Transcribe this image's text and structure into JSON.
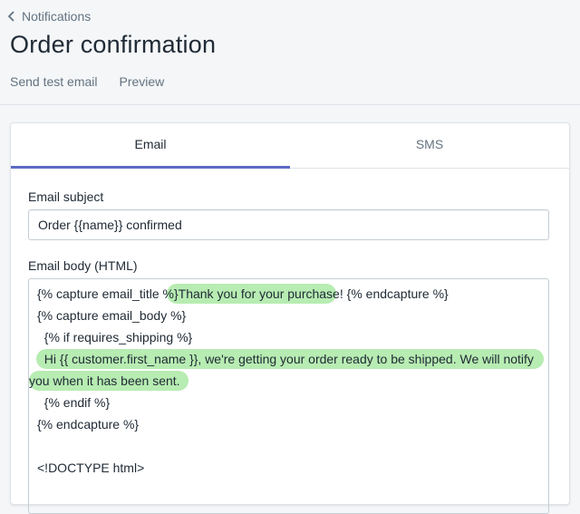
{
  "breadcrumb": {
    "label": "Notifications"
  },
  "page": {
    "title": "Order confirmation"
  },
  "actions": {
    "send_test": "Send test email",
    "preview": "Preview"
  },
  "tabs": [
    {
      "label": "Email",
      "active": true
    },
    {
      "label": "SMS",
      "active": false
    }
  ],
  "subject": {
    "label": "Email subject",
    "value": "Order {{name}} confirmed"
  },
  "body": {
    "label": "Email body (HTML)",
    "lines": [
      {
        "pre": "{% capture email_title %}",
        "highlight": "Thank you for your purchase!",
        "post": " {% endcapture %}"
      },
      {
        "pre": "{% capture email_body %}",
        "highlight": "",
        "post": ""
      },
      {
        "pre": "  {% if requires_shipping %}",
        "highlight": "",
        "post": ""
      },
      {
        "pre": "",
        "highlight": "  Hi {{ customer.first_name }}, we're getting your order ready to be shipped. We will notify",
        "post": ""
      },
      {
        "pre": "",
        "highlight": "you when it has been sent.",
        "post": ""
      },
      {
        "pre": "  {% endif %}",
        "highlight": "",
        "post": ""
      },
      {
        "pre": "{% endcapture %}",
        "highlight": "",
        "post": ""
      },
      {
        "pre": "",
        "highlight": "",
        "post": ""
      },
      {
        "pre": "<!DOCTYPE html>",
        "highlight": "",
        "post": ""
      }
    ]
  },
  "colors": {
    "accent": "#5c6ac4",
    "highlight": "#b7ecb2"
  }
}
